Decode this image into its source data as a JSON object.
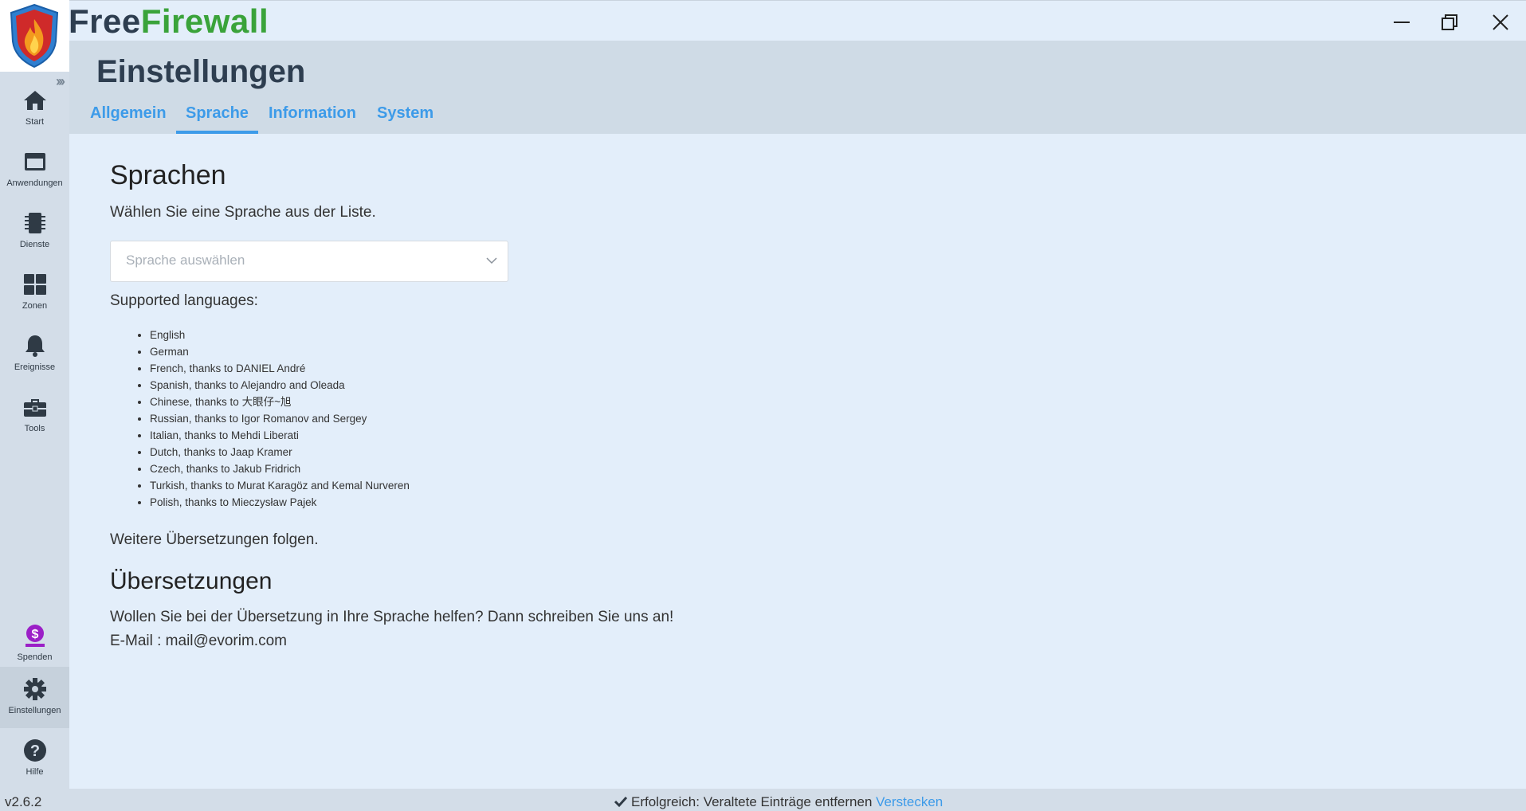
{
  "app": {
    "title_part1": "Free",
    "title_part2": "Firewall",
    "brand_green": "#3aa33a",
    "brand_dark": "#2e3e50",
    "accent": "#3d9be9"
  },
  "window_controls": [
    "minimize-icon",
    "restore-icon",
    "close-icon"
  ],
  "sidebar": {
    "items": [
      {
        "label": "Start",
        "icon": "home-icon"
      },
      {
        "label": "Anwendungen",
        "icon": "window-icon"
      },
      {
        "label": "Dienste",
        "icon": "chip-icon"
      },
      {
        "label": "Zonen",
        "icon": "grid-icon"
      },
      {
        "label": "Ereignisse",
        "icon": "bell-icon"
      },
      {
        "label": "Tools",
        "icon": "toolbox-icon"
      }
    ],
    "bottom_items": [
      {
        "label": "Spenden",
        "icon": "donate-icon"
      },
      {
        "label": "Einstellungen",
        "icon": "gear-icon",
        "active": true
      },
      {
        "label": "Hilfe",
        "icon": "help-icon"
      }
    ]
  },
  "header": {
    "title": "Einstellungen",
    "tabs": [
      {
        "label": "Allgemein"
      },
      {
        "label": "Sprache",
        "active": true
      },
      {
        "label": "Information"
      },
      {
        "label": "System"
      }
    ]
  },
  "main": {
    "languages_heading": "Sprachen",
    "languages_intro": "Wählen Sie eine Sprache aus der Liste.",
    "language_select": {
      "placeholder": "Sprache auswählen"
    },
    "supported_label": "Supported languages:",
    "supported_languages": [
      "English",
      "German",
      "French, thanks to DANIEL André",
      "Spanish, thanks to Alejandro and Oleada",
      "Chinese, thanks to 大眼仔~旭",
      "Russian, thanks to Igor Romanov and Sergey",
      "Italian, thanks to Mehdi Liberati",
      "Dutch, thanks to Jaap Kramer",
      "Czech, thanks to Jakub Fridrich",
      "Turkish, thanks to Murat Karagöz and Kemal Nurveren",
      "Polish, thanks to Mieczysław Pajek"
    ],
    "more_translations": "Weitere Übersetzungen folgen.",
    "translations_heading": "Übersetzungen",
    "translations_help": "Wollen Sie bei der Übersetzung in Ihre Sprache helfen? Dann schreiben Sie uns an!",
    "email_line": "E-Mail : mail@evorim.com"
  },
  "status": {
    "version": "v2.6.2",
    "message": "Erfolgreich: Veraltete Einträge entfernen",
    "hide_link": "Verstecken"
  }
}
